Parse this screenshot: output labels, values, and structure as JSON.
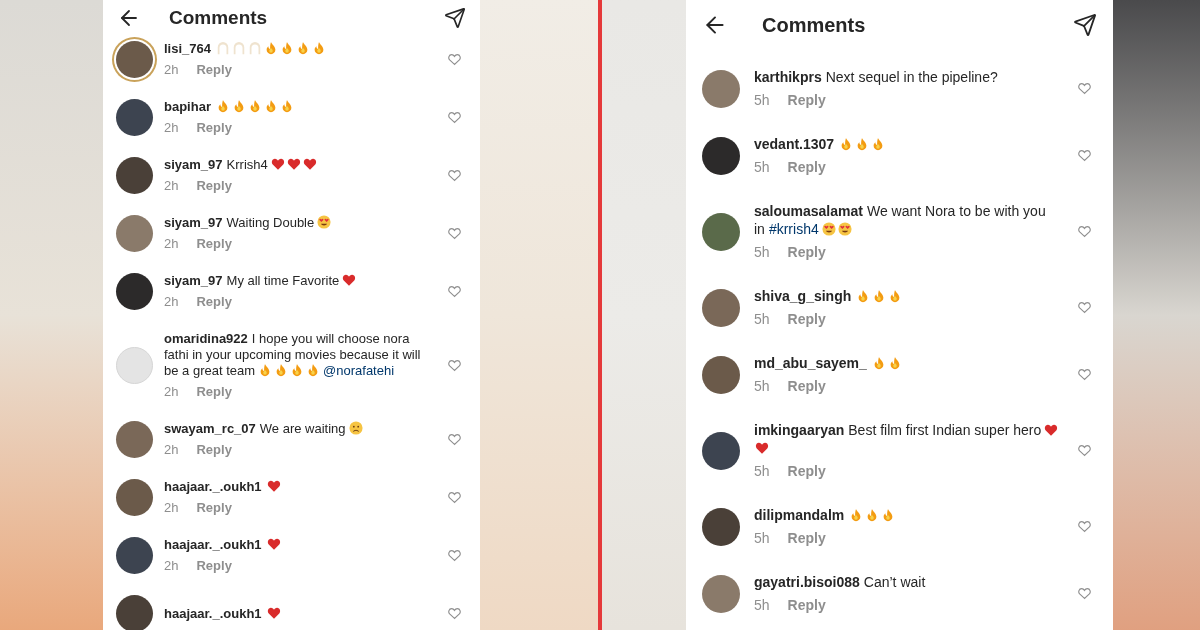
{
  "panels": [
    {
      "title": "Comments",
      "comments": [
        {
          "user": "lisi_764",
          "avatar": {
            "kind": "photo",
            "ring": true
          },
          "liked": false,
          "time": "2h",
          "reply": "Reply",
          "body": [
            {
              "kind": "pray"
            },
            {
              "kind": "pray"
            },
            {
              "kind": "pray"
            },
            {
              "kind": "fire"
            },
            {
              "kind": "fire"
            },
            {
              "kind": "fire"
            },
            {
              "kind": "fire"
            }
          ]
        },
        {
          "user": "bapihar",
          "avatar": {
            "kind": "photo",
            "ring": false
          },
          "liked": false,
          "time": "2h",
          "reply": "Reply",
          "body": [
            {
              "kind": "fire"
            },
            {
              "kind": "fire"
            },
            {
              "kind": "fire"
            },
            {
              "kind": "fire"
            },
            {
              "kind": "fire"
            }
          ]
        },
        {
          "user": "siyam_97",
          "avatar": {
            "kind": "photo",
            "ring": false
          },
          "liked": false,
          "time": "2h",
          "reply": "Reply",
          "body": [
            {
              "kind": "text",
              "text": "Krrish4"
            },
            {
              "kind": "heart"
            },
            {
              "kind": "heart"
            },
            {
              "kind": "heart"
            }
          ]
        },
        {
          "user": "siyam_97",
          "avatar": {
            "kind": "photo",
            "ring": false
          },
          "liked": false,
          "time": "2h",
          "reply": "Reply",
          "body": [
            {
              "kind": "text",
              "text": "Waiting Double"
            },
            {
              "kind": "heart_eyes"
            }
          ]
        },
        {
          "user": "siyam_97",
          "avatar": {
            "kind": "photo",
            "ring": false
          },
          "liked": false,
          "time": "2h",
          "reply": "Reply",
          "body": [
            {
              "kind": "text",
              "text": "My all time Favorite"
            },
            {
              "kind": "heart"
            }
          ]
        },
        {
          "user": "omaridina922",
          "avatar": {
            "kind": "default",
            "ring": false
          },
          "liked": false,
          "time": "2h",
          "reply": "Reply",
          "body": [
            {
              "kind": "text",
              "text": "I hope you will choose nora fathi in your upcoming movies because it will be a great team"
            },
            {
              "kind": "fire"
            },
            {
              "kind": "fire"
            },
            {
              "kind": "fire"
            },
            {
              "kind": "fire"
            },
            {
              "kind": "link",
              "text": "@norafatehi"
            }
          ]
        },
        {
          "user": "swayam_rc_07",
          "avatar": {
            "kind": "photo",
            "ring": false
          },
          "liked": false,
          "time": "2h",
          "reply": "Reply",
          "body": [
            {
              "kind": "text",
              "text": "We are waiting"
            },
            {
              "kind": "sad"
            }
          ]
        },
        {
          "user": "haajaar._.oukh1",
          "avatar": {
            "kind": "photo",
            "ring": false
          },
          "liked": false,
          "time": "2h",
          "reply": "Reply",
          "body": [
            {
              "kind": "heart"
            }
          ]
        },
        {
          "user": "haajaar._.oukh1",
          "avatar": {
            "kind": "photo",
            "ring": false
          },
          "liked": false,
          "time": "2h",
          "reply": "Reply",
          "body": [
            {
              "kind": "heart"
            }
          ]
        },
        {
          "user": "haajaar._.oukh1",
          "avatar": {
            "kind": "photo",
            "ring": false
          },
          "liked": false,
          "body": [
            {
              "kind": "heart"
            }
          ]
        }
      ]
    },
    {
      "title": "Comments",
      "comments": [
        {
          "user": "karthikprs",
          "avatar": {
            "kind": "photo",
            "ring": false
          },
          "liked": false,
          "time": "5h",
          "reply": "Reply",
          "body": [
            {
              "kind": "text",
              "text": "Next sequel in the pipeline?"
            }
          ]
        },
        {
          "user": "vedant.1307",
          "avatar": {
            "kind": "photo",
            "ring": false
          },
          "liked": false,
          "time": "5h",
          "reply": "Reply",
          "body": [
            {
              "kind": "fire"
            },
            {
              "kind": "fire"
            },
            {
              "kind": "fire"
            }
          ]
        },
        {
          "user": "saloumasalamat",
          "avatar": {
            "kind": "photo",
            "ring": false
          },
          "liked": false,
          "time": "5h",
          "reply": "Reply",
          "body": [
            {
              "kind": "text",
              "text": "We want Nora to be with you in"
            },
            {
              "kind": "link",
              "text": "#krrish4"
            },
            {
              "kind": "heart_eyes"
            },
            {
              "kind": "heart_eyes"
            }
          ]
        },
        {
          "user": "shiva_g_singh",
          "avatar": {
            "kind": "photo",
            "ring": false
          },
          "liked": false,
          "time": "5h",
          "reply": "Reply",
          "body": [
            {
              "kind": "fire"
            },
            {
              "kind": "fire"
            },
            {
              "kind": "fire"
            }
          ]
        },
        {
          "user": "md_abu_sayem_",
          "avatar": {
            "kind": "photo",
            "ring": false
          },
          "liked": false,
          "time": "5h",
          "reply": "Reply",
          "body": [
            {
              "kind": "fire"
            },
            {
              "kind": "fire"
            }
          ]
        },
        {
          "user": "imkingaaryan",
          "avatar": {
            "kind": "photo",
            "ring": false
          },
          "liked": false,
          "time": "5h",
          "reply": "Reply",
          "body": [
            {
              "kind": "text",
              "text": "Best film first Indian super hero"
            },
            {
              "kind": "heart"
            },
            {
              "kind": "heart"
            }
          ]
        },
        {
          "user": "dilipmandalm",
          "avatar": {
            "kind": "photo",
            "ring": false
          },
          "liked": false,
          "time": "5h",
          "reply": "Reply",
          "body": [
            {
              "kind": "fire"
            },
            {
              "kind": "fire"
            },
            {
              "kind": "fire"
            }
          ]
        },
        {
          "user": "gayatri.bisoi088",
          "avatar": {
            "kind": "photo",
            "ring": false
          },
          "liked": false,
          "time": "5h",
          "reply": "Reply",
          "body": [
            {
              "kind": "text",
              "text": "Can’t wait"
            }
          ]
        }
      ]
    }
  ]
}
